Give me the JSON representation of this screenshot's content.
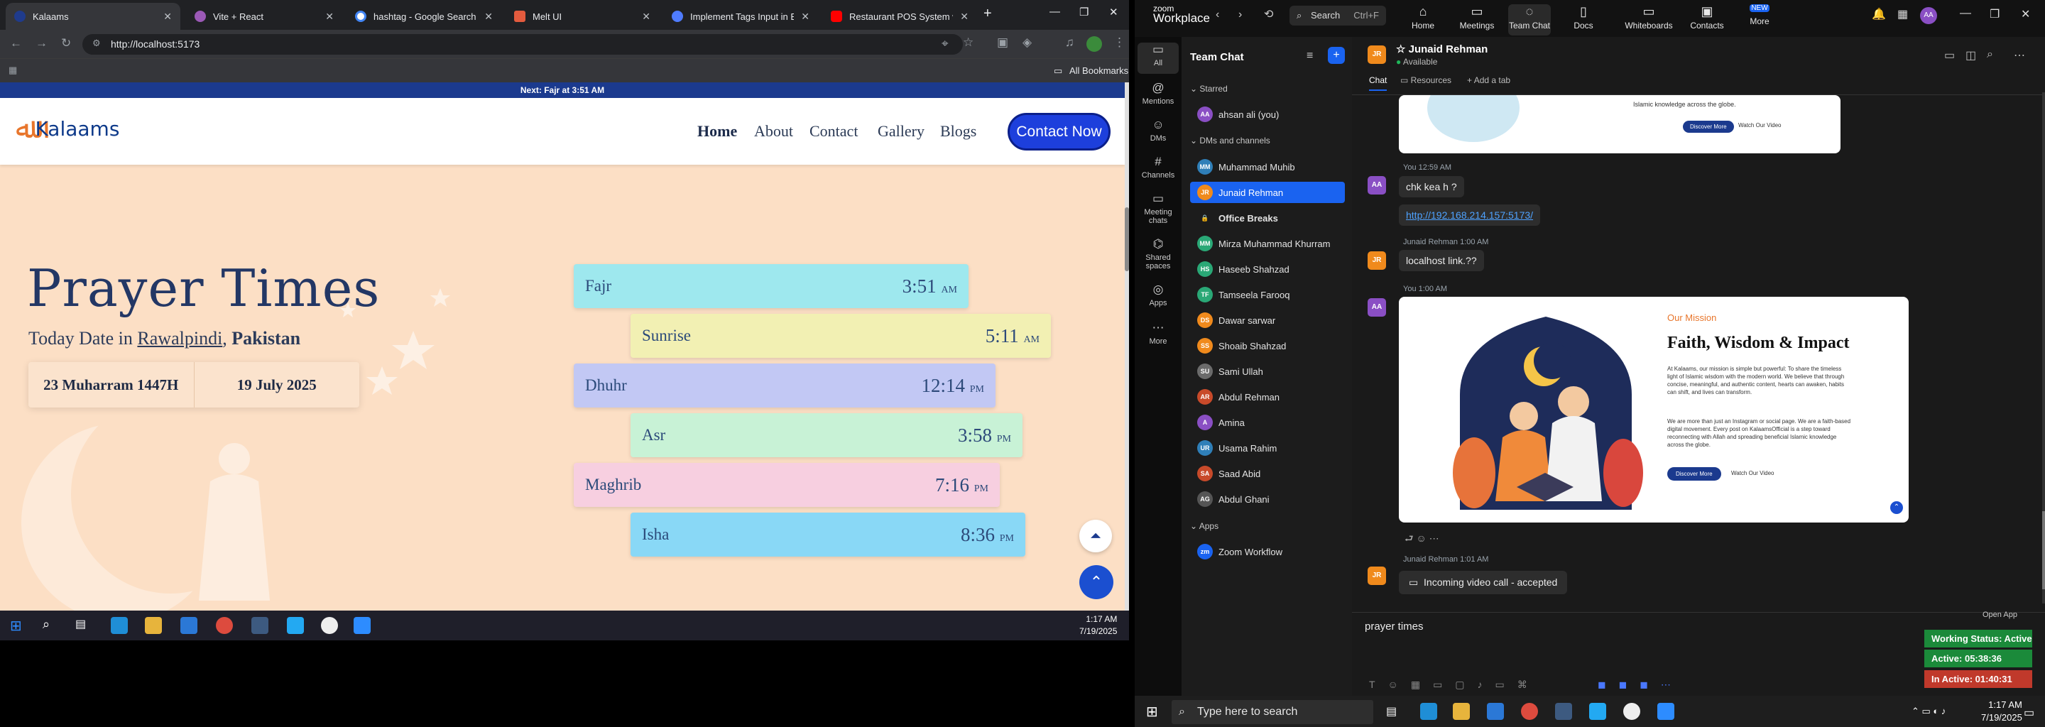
{
  "browser": {
    "tabs": [
      {
        "title": "Kalaams",
        "color": "#1f3b8c"
      },
      {
        "title": "Vite + React",
        "color": "#9b59b6"
      },
      {
        "title": "hashtag - Google Search",
        "color": "#4285f4"
      },
      {
        "title": "Melt UI",
        "color": "#e35b3e"
      },
      {
        "title": "Implement Tags Input in Blo",
        "color": "#4f7cff"
      },
      {
        "title": "Restaurant POS System with",
        "color": "#ff0000"
      }
    ],
    "url": "http://localhost:5173",
    "bookmarks_label": "All Bookmarks"
  },
  "site": {
    "announcement": "Next: Fajr at 3:51 AM",
    "logo_text": "Kalaams",
    "nav": [
      "Home",
      "About",
      "Contact",
      "Gallery",
      "Blogs"
    ],
    "contact_button": "Contact Now",
    "title": "Prayer Times",
    "date_prefix": "Today Date in",
    "city": "Rawalpindi",
    "country": "Pakistan",
    "hijri_date": "23 Muharram 1447H",
    "gregorian_date": "19 July 2025",
    "prayers": [
      {
        "name": "Fajr",
        "time": "3:51",
        "ampm": "AM",
        "color": "#9ee8ee"
      },
      {
        "name": "Sunrise",
        "time": "5:11",
        "ampm": "AM",
        "color": "#f2f0b3"
      },
      {
        "name": "Dhuhr",
        "time": "12:14",
        "ampm": "PM",
        "color": "#c2c8f4"
      },
      {
        "name": "Asr",
        "time": "3:58",
        "ampm": "PM",
        "color": "#c8f2d6"
      },
      {
        "name": "Maghrib",
        "time": "7:16",
        "ampm": "PM",
        "color": "#f7cfe0"
      },
      {
        "name": "Isha",
        "time": "8:36",
        "ampm": "PM",
        "color": "#89d8f6"
      }
    ]
  },
  "left_taskbar": {
    "time": "1:17 AM",
    "date": "7/19/2025"
  },
  "zoom": {
    "brand": "zoom",
    "brand_sub": "Workplace",
    "search": "Search",
    "search_shortcut": "Ctrl+F",
    "tabs": [
      "Home",
      "Meetings",
      "Team Chat",
      "Docs",
      "Whiteboards",
      "Contacts",
      "More"
    ],
    "more_badge": "NEW",
    "rail": [
      "All",
      "Mentions",
      "DMs",
      "Channels",
      "Meeting chats",
      "Shared spaces",
      "Apps",
      "More"
    ],
    "panel_title": "Team Chat",
    "sections": {
      "starred": "Starred",
      "dms": "DMs and channels",
      "apps": "Apps"
    },
    "starred_item": {
      "name": "ahsan ali (you)",
      "initials": "AA",
      "color": "#8a4fc4"
    },
    "contacts": [
      {
        "name": "Muhammad Muhib",
        "initials": "MM",
        "color": "#2f7fb8"
      },
      {
        "name": "Junaid Rehman",
        "initials": "JR",
        "color": "#f08a1c"
      },
      {
        "name": "Office Breaks",
        "initials": "🔒",
        "color": "#1c1c1c"
      },
      {
        "name": "Mirza Muhammad Khurram",
        "initials": "MM",
        "color": "#2aa876"
      },
      {
        "name": "Haseeb Shahzad",
        "initials": "HS",
        "color": "#2aa876"
      },
      {
        "name": "Tamseela Farooq",
        "initials": "TF",
        "color": "#2aa876"
      },
      {
        "name": "Dawar sarwar",
        "initials": "DS",
        "color": "#f08a1c"
      },
      {
        "name": "Shoaib Shahzad",
        "initials": "SS",
        "color": "#f08a1c"
      },
      {
        "name": "Sami Ullah",
        "initials": "SU",
        "color": "#6b6b6b"
      },
      {
        "name": "Abdul Rehman",
        "initials": "AR",
        "color": "#c84a2a"
      },
      {
        "name": "Amina",
        "initials": "A",
        "color": "#8a4fc4"
      },
      {
        "name": "Usama Rahim",
        "initials": "UR",
        "color": "#2f7fb8"
      },
      {
        "name": "Saad Abid",
        "initials": "SA",
        "color": "#c84a2a"
      },
      {
        "name": "Abdul Ghani",
        "initials": "AG",
        "color": "#555555"
      }
    ],
    "app_item": "Zoom Workflow",
    "chat_header": {
      "name": "Junaid Rehman",
      "status": "Available",
      "initials": "JR"
    },
    "chat_tabs": [
      "Chat",
      "Resources",
      "Add a tab"
    ],
    "messages": [
      {
        "meta": "You 12:59 AM",
        "text": "chk kea h ?",
        "initials": "AA"
      },
      {
        "meta": "",
        "text": "http://192.168.214.157:5173/"
      },
      {
        "meta": "Junaid Rehman 1:00 AM",
        "text": "localhost link.??",
        "initials": "JR"
      },
      {
        "meta": "You 1:00 AM",
        "initials": "AA"
      },
      {
        "meta": "Junaid Rehman 1:01 AM",
        "text": "Incoming video call - accepted",
        "initials": "JR"
      }
    ],
    "top_card": {
      "line": "Islamic knowledge across the globe.",
      "btn1": "Discover More",
      "btn2": "Watch Our Video"
    },
    "card": {
      "eyebrow": "Our Mission",
      "heading": "Faith, Wisdom & Impact",
      "para1": "At Kalaams, our mission is simple but powerful: To share the timeless light of Islamic wisdom with the modern world. We believe that through concise, meaningful, and authentic content, hearts can awaken, habits can shift, and lives can transform.",
      "para2": "We are more than just an Instagram or social page. We are a faith-based digital movement. Every post on KalaamsOfficial is a step toward reconnecting with Allah and spreading beneficial Islamic knowledge across the globe.",
      "btn1": "Discover More",
      "btn2": "Watch Our Video"
    },
    "compose_text": "prayer times",
    "open_app": "Open App",
    "statuses": [
      {
        "text": "Working Status: Active",
        "color": "#1b8a3a"
      },
      {
        "text": "Active: 05:38:36",
        "color": "#1b8a3a"
      },
      {
        "text": "In Active: 01:40:31",
        "color": "#c0392b"
      }
    ]
  },
  "right_taskbar": {
    "search": "Type here to search",
    "time": "1:17 AM",
    "date": "7/19/2025"
  }
}
